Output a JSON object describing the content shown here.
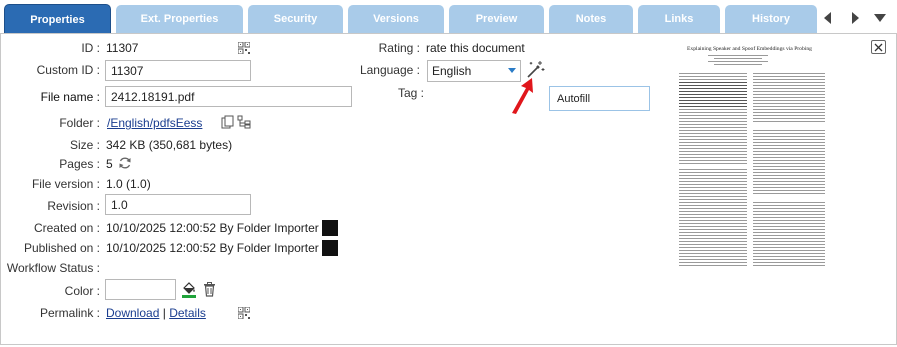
{
  "tabs": [
    {
      "label": "Properties",
      "active": true
    },
    {
      "label": "Ext. Properties",
      "active": false
    },
    {
      "label": "Security",
      "active": false
    },
    {
      "label": "Versions",
      "active": false
    },
    {
      "label": "Preview",
      "active": false
    },
    {
      "label": "Notes",
      "active": false
    },
    {
      "label": "Links",
      "active": false
    },
    {
      "label": "History",
      "active": false
    }
  ],
  "tab_nav": {
    "prev_icon": "chevron-left-icon",
    "next_icon": "chevron-right-icon",
    "menu_icon": "caret-down-icon"
  },
  "fields": {
    "id_label": "ID :",
    "id_value": "11307",
    "custom_id_label": "Custom ID :",
    "custom_id_value": "11307",
    "file_name_label": "File name :",
    "file_name_value": "2412.18191.pdf",
    "folder_label": "Folder :",
    "folder_value": "/English/pdfsEess",
    "size_label": "Size :",
    "size_value": "342 KB (350,681 bytes)",
    "pages_label": "Pages :",
    "pages_value": "5",
    "file_version_label": "File version :",
    "file_version_value": "1.0 (1.0)",
    "revision_label": "Revision :",
    "revision_value": "1.0",
    "created_label": "Created on :",
    "created_value": "10/10/2025 12:00:52 By Folder Importer",
    "published_label": "Published on :",
    "published_value": "10/10/2025 12:00:52 By Folder Importer",
    "workflow_label": "Workflow Status :",
    "color_label": "Color :",
    "permalink_label": "Permalink :",
    "permalink_download": "Download",
    "permalink_sep": "|",
    "permalink_details": "Details"
  },
  "right": {
    "rating_label": "Rating :",
    "rating_value": "rate this document",
    "language_label": "Language :",
    "language_value": "English",
    "tag_label": "Tag :",
    "autofill_label": "Autofill"
  },
  "thumbnail": {
    "title": "Explaining Speaker and Spoof Embeddings via Probing"
  },
  "colors": {
    "tab_active": "#2b6bb3",
    "tab_inactive": "#a9cbe9",
    "link": "#1a3d8f",
    "arrow_red": "#e0161b",
    "fill_green": "#1fa33a"
  }
}
